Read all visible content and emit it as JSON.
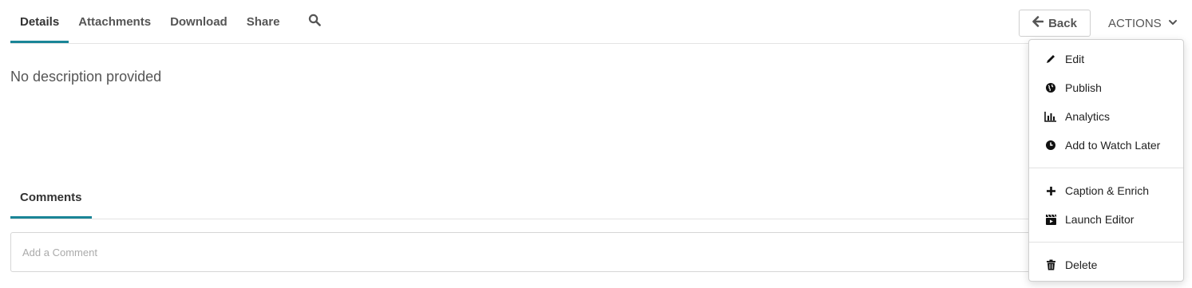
{
  "tabs": [
    {
      "label": "Details",
      "active": true
    },
    {
      "label": "Attachments",
      "active": false
    },
    {
      "label": "Download",
      "active": false
    },
    {
      "label": "Share",
      "active": false
    }
  ],
  "icons": {
    "search": "search-icon",
    "back": "arrow-left-icon",
    "actions": "chevron-down-icon"
  },
  "description": "No description provided",
  "comments": {
    "tab_label": "Comments",
    "placeholder": "Add a Comment"
  },
  "header": {
    "back_label": "Back",
    "actions_label": "ACTIONS"
  },
  "actions_menu": {
    "group1": [
      {
        "label": "Edit",
        "icon": "pencil-icon"
      },
      {
        "label": "Publish",
        "icon": "globe-icon"
      },
      {
        "label": "Analytics",
        "icon": "bar-chart-icon"
      },
      {
        "label": "Add to Watch Later",
        "icon": "clock-icon"
      }
    ],
    "group2": [
      {
        "label": "Caption & Enrich",
        "icon": "plus-icon"
      },
      {
        "label": "Launch Editor",
        "icon": "clapperboard-icon"
      }
    ],
    "group3": [
      {
        "label": "Delete",
        "icon": "trash-icon"
      }
    ]
  },
  "colors": {
    "accent": "#1a8597",
    "text": "#333333",
    "border": "#d6d6d6"
  }
}
